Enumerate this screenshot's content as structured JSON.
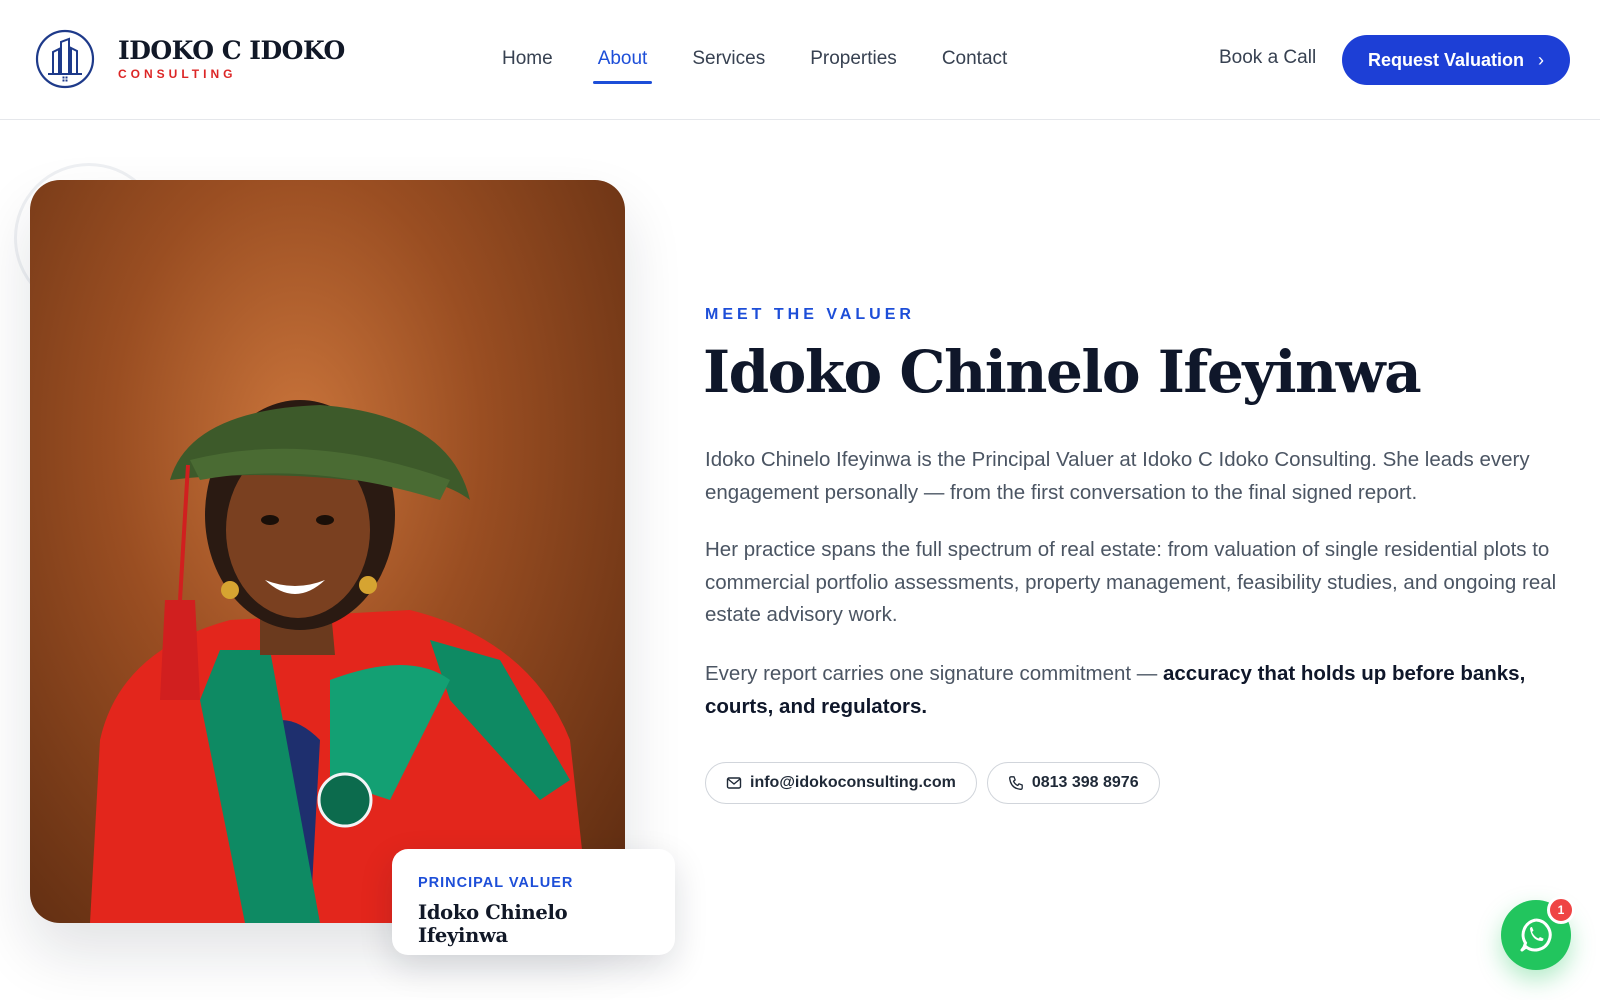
{
  "brand": {
    "name": "IDOKO C IDOKO",
    "tagline": "CONSULTING",
    "accent": "#dc2626",
    "primary": "#1d3fd6"
  },
  "nav": {
    "items": [
      {
        "label": "Home",
        "active": false
      },
      {
        "label": "About",
        "active": true
      },
      {
        "label": "Services",
        "active": false
      },
      {
        "label": "Properties",
        "active": false
      },
      {
        "label": "Contact",
        "active": false
      }
    ],
    "book_call": "Book a Call",
    "cta_label": "Request Valuation",
    "cta_icon": "chevron-right-icon"
  },
  "hero": {
    "eyebrow": "MEET THE VALUER",
    "title": "Idoko Chinelo Ifeyinwa",
    "paragraphs": [
      "Idoko Chinelo Ifeyinwa is the Principal Valuer at Idoko C Idoko Consulting. She leads every engagement personally — from the first conversation to the final signed report.",
      "Her practice spans the full spectrum of real estate: from valuation of single residential plots to commercial portfolio assessments, property management, feasibility studies, and ongoing real estate advisory work."
    ],
    "commitment_lead": "Every report carries one signature commitment — ",
    "commitment_bold": "accuracy that holds up before banks, courts, and regulators."
  },
  "contacts": {
    "email": "info@idokoconsulting.com",
    "phone": "0813 398 8976",
    "email_icon": "mail-icon",
    "phone_icon": "phone-icon"
  },
  "profile_card": {
    "role": "PRINCIPAL VALUER",
    "name": "Idoko Chinelo Ifeyinwa"
  },
  "whatsapp": {
    "icon": "whatsapp-icon",
    "badge_count": "1"
  }
}
